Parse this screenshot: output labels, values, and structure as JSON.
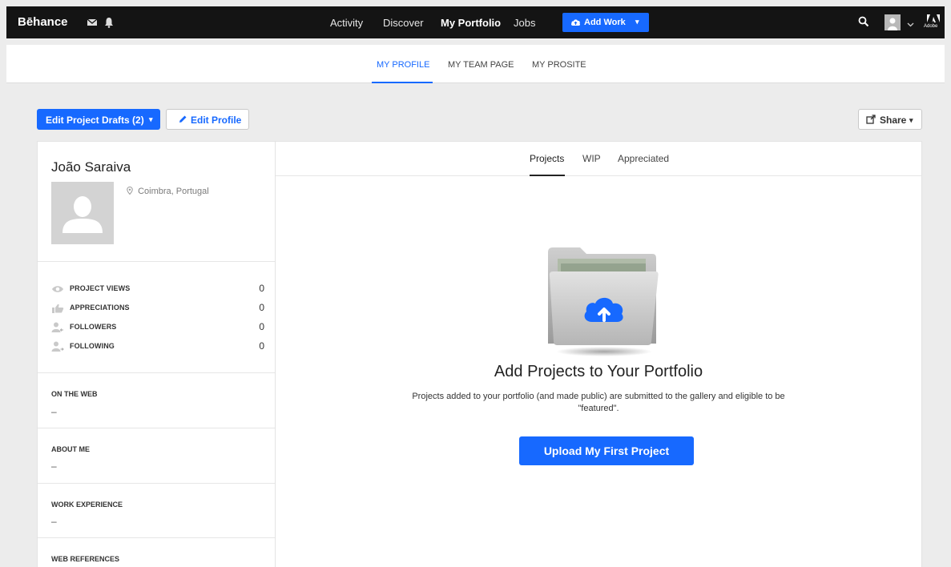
{
  "topbar": {
    "brand": "Bēhance",
    "nav": [
      "Activity",
      "Discover",
      "My Portfolio",
      "Jobs"
    ],
    "add_work": "Add Work",
    "adobe": "Adobe"
  },
  "subnav": {
    "items": [
      "MY PROFILE",
      "MY TEAM PAGE",
      "MY PROSITE"
    ]
  },
  "actions": {
    "edit_drafts": "Edit Project Drafts (2)",
    "edit_profile": "Edit Profile",
    "share": "Share"
  },
  "profile": {
    "name": "João Saraiva",
    "location": "Coimbra, Portugal",
    "stats": [
      {
        "label": "PROJECT VIEWS",
        "value": "0",
        "icon": "eye-icon"
      },
      {
        "label": "APPRECIATIONS",
        "value": "0",
        "icon": "thumbs-up-icon"
      },
      {
        "label": "FOLLOWERS",
        "value": "0",
        "icon": "followers-icon"
      },
      {
        "label": "FOLLOWING",
        "value": "0",
        "icon": "following-icon"
      }
    ],
    "sections": [
      {
        "title": "ON THE WEB",
        "value": "–"
      },
      {
        "title": "ABOUT ME",
        "value": "–"
      },
      {
        "title": "WORK EXPERIENCE",
        "value": "–"
      },
      {
        "title": "WEB REFERENCES",
        "value": ""
      }
    ]
  },
  "main": {
    "tabs": [
      "Projects",
      "WIP",
      "Appreciated"
    ],
    "empty_title": "Add Projects to Your Portfolio",
    "empty_desc": "Projects added to your portfolio (and made public) are submitted to the gallery and eligible to be \"featured\".",
    "upload_button": "Upload My First Project"
  },
  "colors": {
    "accent": "#1769ff",
    "topbar": "#141414",
    "background": "#ececec"
  }
}
